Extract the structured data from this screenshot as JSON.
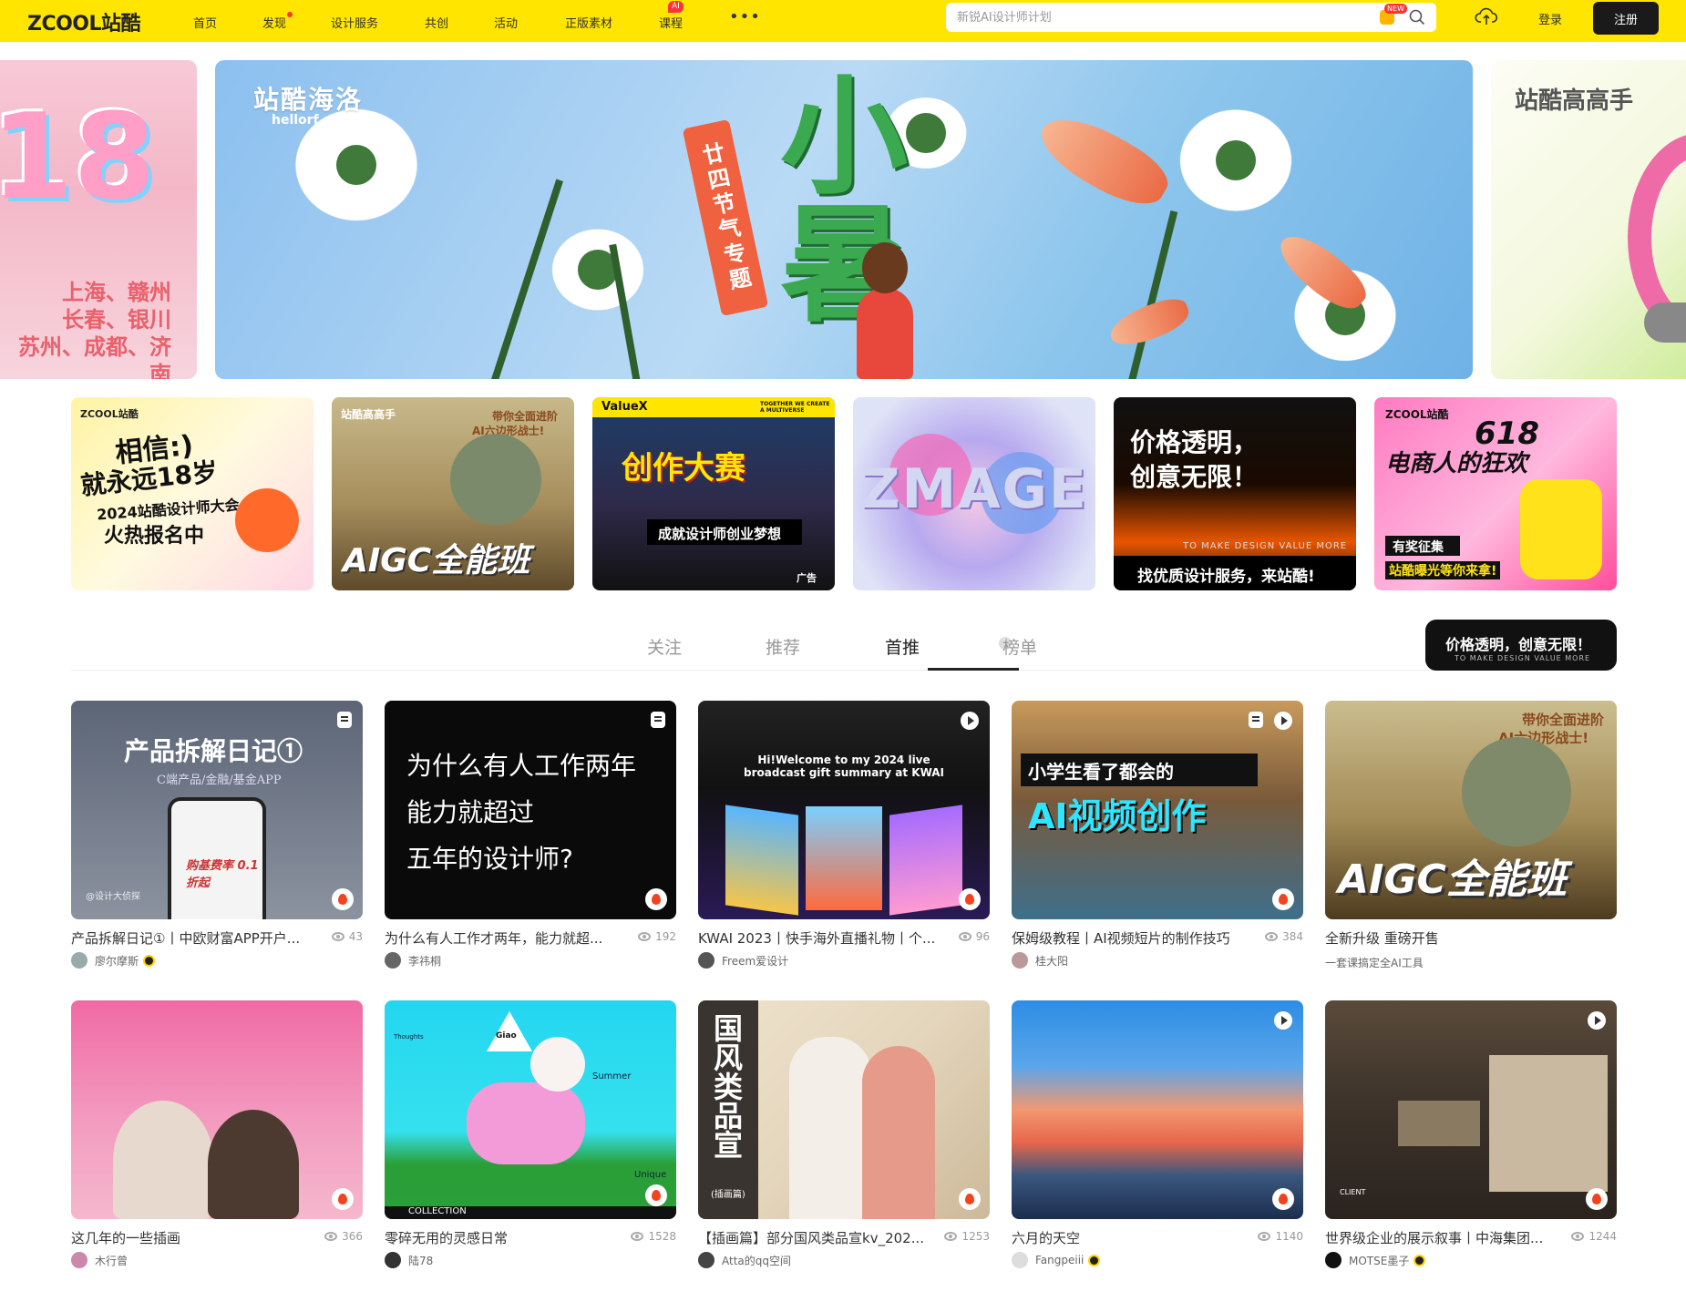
{
  "header": {
    "logo": "ZCOOL站酷",
    "nav": [
      {
        "label": "首页"
      },
      {
        "label": "发现"
      },
      {
        "label": "设计服务"
      },
      {
        "label": "共创"
      },
      {
        "label": "活动"
      },
      {
        "label": "正版素材"
      },
      {
        "label": "课程",
        "badge": "AI"
      }
    ],
    "more": "•••",
    "search_placeholder": "新锐AI设计师计划",
    "search_new_badge": "NEW",
    "login": "登录",
    "register": "注册"
  },
  "hero": {
    "left": {
      "number": "18",
      "cities": [
        "上海、赣州",
        "长春、银川",
        "苏州、成都、济南"
      ]
    },
    "main": {
      "title_cn": "站酷海洛",
      "title_en": "hellorf.com",
      "tag": "廿四节气专题",
      "big": "小暑"
    },
    "right": {
      "title": "站酷高高手"
    }
  },
  "promos": [
    {
      "text1": "ZCOOL站酷",
      "text2": "相信:)",
      "text3": "就永远18岁",
      "text4": "2024站酷设计师大会",
      "text5": "火热报名中"
    },
    {
      "text1": "站酷高高手",
      "text2": "带你全面进阶",
      "text3": "AI六边形战士!",
      "text4": "AIGC全能班"
    },
    {
      "text1": "ValueX",
      "text2": "TOGETHER WE CREATE A MULTIVERSE",
      "text3": "创作大赛",
      "text4": "成就设计师创业梦想",
      "text5": "广告"
    },
    {
      "text1": "ZMAGE"
    },
    {
      "text1": "价格透明，",
      "text2": "创意无限！",
      "text3": "TO MAKE DESIGN VALUE MORE",
      "text4": "找优质设计服务，来站酷!"
    },
    {
      "text1": "ZCOOL站酷",
      "text2": "618",
      "text3": "电商人的狂欢",
      "text4": "有奖征集",
      "text5": "站酷曝光等你来拿!"
    }
  ],
  "tabs": {
    "items": [
      "关注",
      "推荐",
      "首推",
      "榜单"
    ],
    "help": "?",
    "banner_main": "价格透明，创意无限！",
    "banner_sub": "TO MAKE DESIGN VALUE MORE"
  },
  "cards": [
    {
      "title": "产品拆解日记①丨中欧财富APP开户...",
      "views": "43",
      "author": "廖尔摩斯",
      "thumb_title": "产品拆解日记①",
      "thumb_sub": "C端产品/金融/基金APP",
      "thumb_credit": "@设计大侦探",
      "thumb_phone": "购基费率 0.1折起"
    },
    {
      "title": "为什么有人工作才两年，能力就超...",
      "views": "192",
      "author": "李祎桐",
      "thumb_lines": [
        "为什么有人工作两年",
        "能力就超过",
        "五年的设计师?"
      ]
    },
    {
      "title": "KWAI 2023丨快手海外直播礼物丨个...",
      "views": "96",
      "author": "Freem爱设计",
      "thumb_title": "Hi!Welcome to my 2024 live broadcast gift summary at KWAI"
    },
    {
      "title": "保姆级教程丨AI视频短片的制作技巧",
      "views": "384",
      "author": "桂大阳",
      "thumb_title": "小学生看了都会的",
      "thumb_big": "AI视频创作"
    },
    {
      "title": "全新升级 重磅开售",
      "views": "",
      "author": "一套课搞定全AI工具",
      "thumb_top": "带你全面进阶",
      "thumb_top2": "AI六边形战士!",
      "thumb_big": "AIGC全能班"
    },
    {
      "title": "这几年的一些插画",
      "views": "366",
      "author": "木行曾"
    },
    {
      "title": "零碎无用的灵感日常",
      "views": "1528",
      "author": "陆78",
      "thumb_a": "Thoughts",
      "thumb_b": "Summer",
      "thumb_c": "Unique",
      "thumb_d": "COLLECTION",
      "thumb_e": "Giao"
    },
    {
      "title": "【插画篇】部分国风类品宣kv_202...",
      "views": "1253",
      "author": "Atta的qq空间",
      "thumb_big": "国风类品宣",
      "thumb_small": "(插画篇)"
    },
    {
      "title": "六月的天空",
      "views": "1140",
      "author": "Fangpeiii"
    },
    {
      "title": "世界级企业的展示叙事丨中海集团...",
      "views": "1244",
      "author": "MOTSE墨子",
      "thumb_client": "CLIENT"
    }
  ]
}
